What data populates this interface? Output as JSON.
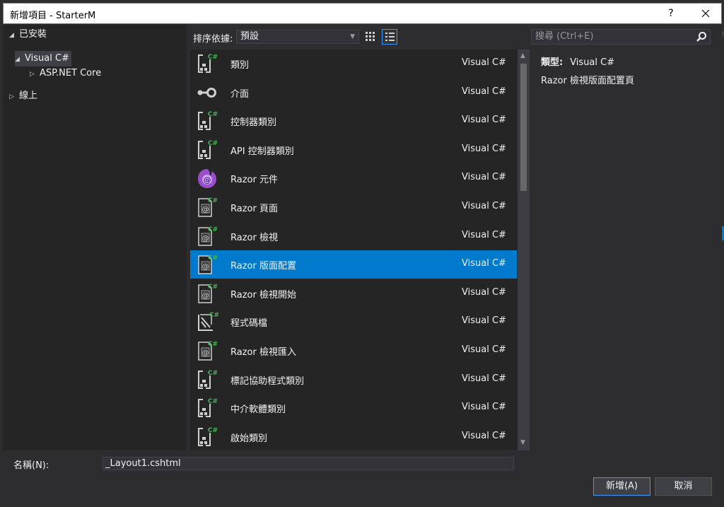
{
  "window": {
    "title": "新增項目 - StarterM",
    "help": "?",
    "close": "✕"
  },
  "tree": {
    "installed": "已安裝",
    "visual_csharp": "Visual C#",
    "aspnet_core": "ASP.NET Core",
    "online": "線上"
  },
  "toolbar": {
    "sort_label": "排序依據:",
    "sort_value": "預設"
  },
  "search": {
    "placeholder": "搜尋 (Ctrl+E)"
  },
  "items": [
    {
      "name": "類別",
      "lang": "Visual C#",
      "icon": "class-icon"
    },
    {
      "name": "介面",
      "lang": "Visual C#",
      "icon": "interface-icon"
    },
    {
      "name": "控制器類別",
      "lang": "Visual C#",
      "icon": "class-icon"
    },
    {
      "name": "API 控制器類別",
      "lang": "Visual C#",
      "icon": "class-icon"
    },
    {
      "name": "Razor 元件",
      "lang": "Visual C#",
      "icon": "razor-component-icon"
    },
    {
      "name": "Razor 頁面",
      "lang": "Visual C#",
      "icon": "razor-page-icon"
    },
    {
      "name": "Razor 檢視",
      "lang": "Visual C#",
      "icon": "razor-page-icon"
    },
    {
      "name": "Razor 版面配置",
      "lang": "Visual C#",
      "icon": "razor-page-icon",
      "selected": true
    },
    {
      "name": "Razor 檢視開始",
      "lang": "Visual C#",
      "icon": "razor-page-icon"
    },
    {
      "name": "程式碼檔",
      "lang": "Visual C#",
      "icon": "code-file-icon"
    },
    {
      "name": "Razor 檢視匯入",
      "lang": "Visual C#",
      "icon": "razor-page-icon"
    },
    {
      "name": "標記協助程式類別",
      "lang": "Visual C#",
      "icon": "class-icon"
    },
    {
      "name": "中介軟體類別",
      "lang": "Visual C#",
      "icon": "class-icon"
    },
    {
      "name": "啟始類別",
      "lang": "Visual C#",
      "icon": "class-icon"
    }
  ],
  "info": {
    "type_label": "類型:",
    "type_value": "Visual C#",
    "description": "Razor 檢視版面配置頁"
  },
  "footer": {
    "name_label": "名稱(N):",
    "name_value": "_Layout1.cshtml",
    "add_button": "新增(A)",
    "cancel_button": "取消"
  },
  "colors": {
    "selection": "#007acc",
    "csharp_green": "#3fb950",
    "razor_purple": "#9b4dca"
  }
}
